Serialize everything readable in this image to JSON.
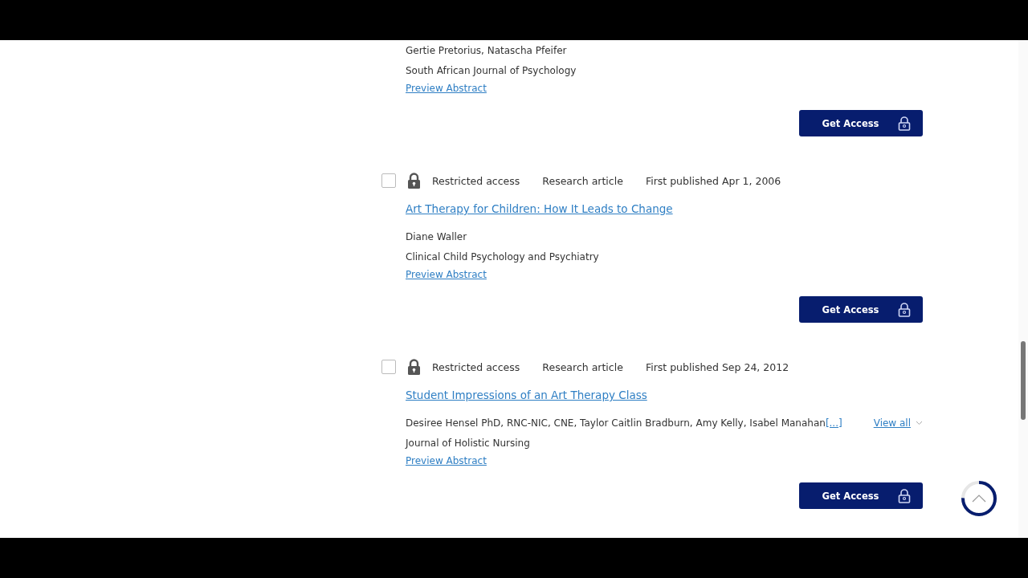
{
  "results": [
    {
      "authors": "Gertie Pretorius, Natascha Pfeifer",
      "journal": "South African Journal of Psychology",
      "preview": "Preview Abstract",
      "button": "Get Access"
    },
    {
      "checked": false,
      "access": "Restricted access",
      "type": "Research article",
      "published": "First published Apr 1, 2006",
      "title": "Art Therapy for Children: How It Leads to Change",
      "authors": "Diane Waller",
      "journal": "Clinical Child Psychology and Psychiatry",
      "preview": "Preview Abstract",
      "button": "Get Access"
    },
    {
      "checked": false,
      "access": "Restricted access",
      "type": "Research article",
      "published": "First published Sep 24, 2012",
      "title": "Student Impressions of an Art Therapy Class",
      "authors": "Desiree Hensel PhD, RNC-NIC, CNE, Taylor Caitlin Bradburn, Amy Kelly, Isabel Manahan",
      "more": "[...]",
      "view_all": "View all",
      "journal": "Journal of Holistic Nursing",
      "preview": "Preview Abstract",
      "button": "Get Access"
    }
  ],
  "back_to_top": {
    "level": 0.75
  }
}
